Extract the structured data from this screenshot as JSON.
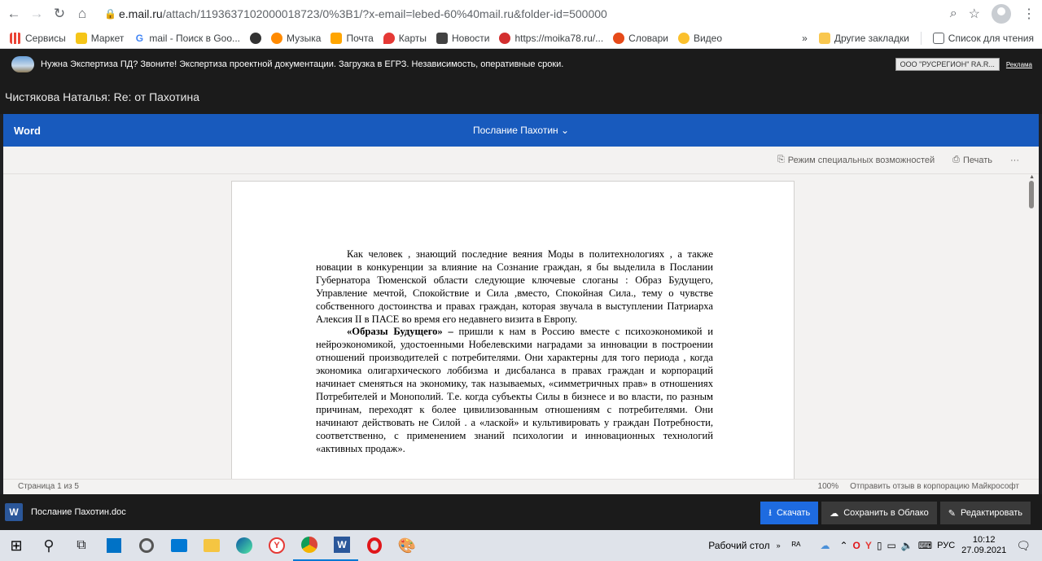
{
  "browser": {
    "url_host": "e.mail.ru",
    "url_rest": "/attach/1193637102000018723/0%3B1/?x-email=lebed-60%40mail.ru&folder-id=500000"
  },
  "bookmarks": {
    "items": [
      "Сервисы",
      "Маркет",
      "mail - Поиск в Goo...",
      "Музыка",
      "Почта",
      "Карты",
      "Новости",
      "https://moika78.ru/...",
      "Словари",
      "Видео"
    ],
    "overflow": "»",
    "other": "Другие закладки",
    "reading_list": "Список для чтения"
  },
  "ad": {
    "text": "Нужна Экспертиза ПД? Звоните!  Экспертиза проектной документации. Загрузка в ЕГРЗ. Независимость, оперативные сроки.",
    "badge": "ООО \"РУСРЕГИОН\" RA.R...",
    "link": "Реклама"
  },
  "mail": {
    "subject": "Чистякова Наталья: Re: от Пахотина"
  },
  "word": {
    "brand": "Word",
    "doc_title": "Послание Пахотин ⌄",
    "accessibility": "Режим специальных возможностей",
    "print": "Печать",
    "more": "···"
  },
  "document": {
    "p1": "Как человек , знающий последние веяния Моды в политехнологиях , а также новации в конкуренции за влияние на Сознание граждан, я бы выделила в Послании Губернатора Тюменской области следующие ключевые слоганы : Образ Будущего, Управление мечтой, Спокойствие и Сила ,вместо, Спокойная Сила., тему о чувстве собственного достоинства и правах граждан, которая звучала в выступлении Патриарха Алексия II в ПАСЕ во время его недавнего визита в Европу.",
    "p2_bold": "«Образы Будущего» –",
    "p2": " пришли к нам в Россию вместе с психоэкономикой и нейроэкономикой, удостоенными Нобелевскими наградами за инновации в построении отношений производителей с потребителями. Они характерны для того периода , когда экономика олигархического лоббизма и дисбаланса в правах граждан и корпораций начинает сменяться на экономику, так называемых, «симметричных прав» в отношениях Потребителей и Монополий. Т.е. когда субъекты Силы в бизнесе и во власти, по разным причинам, переходят к более цивилизованным отношениям с потребителями. Они начинают действовать не Силой . а «лаской» и культивировать у граждан Потребности, соответственно, с применением знаний психологии и инновационных технологий «активных продаж»."
  },
  "status": {
    "page": "Страница 1 из 5",
    "zoom": "100%",
    "feedback": "Отправить отзыв в корпорацию Майкрософт"
  },
  "file": {
    "name": "Послание Пахотин.doc",
    "download": "Скачать",
    "save_cloud": "Сохранить в Облако",
    "edit": "Редактировать"
  },
  "taskbar": {
    "desktop": "Рабочий стол",
    "lang": "РУС",
    "time": "10:12",
    "date": "27.09.2021"
  }
}
